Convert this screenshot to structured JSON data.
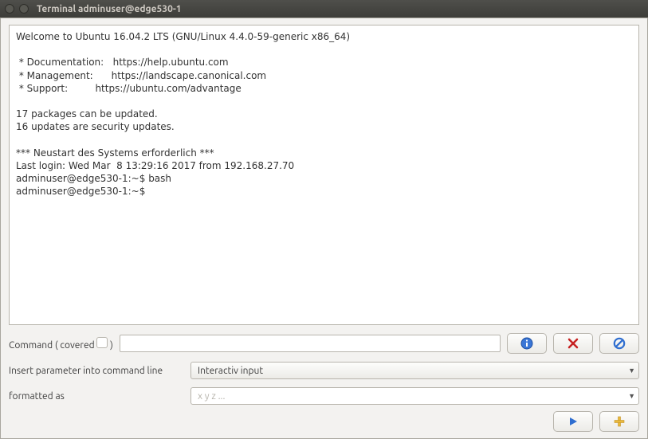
{
  "titlebar": {
    "title": "Terminal adminuser@edge530-1"
  },
  "terminal": {
    "content": "Welcome to Ubuntu 16.04.2 LTS (GNU/Linux 4.4.0-59-generic x86_64)\n\n * Documentation:   https://help.ubuntu.com\n * Management:      https://landscape.canonical.com\n * Support:         https://ubuntu.com/advantage\n\n17 packages can be updated.\n16 updates are security updates.\n\n*** Neustart des Systems erforderlich ***\nLast login: Wed Mar  8 13:29:16 2017 from 192.168.27.70\nadminuser@edge530-1:~$ bash\nadminuser@edge530-1:~$ "
  },
  "command_row": {
    "label_prefix": "Command ( ",
    "label_covered": "covered",
    "label_suffix": " )",
    "input_value": ""
  },
  "param_row": {
    "label": "Insert parameter into command line",
    "selected": "Interactiv input"
  },
  "fmt_row": {
    "label": "formatted as",
    "placeholder": "x y z ..."
  }
}
